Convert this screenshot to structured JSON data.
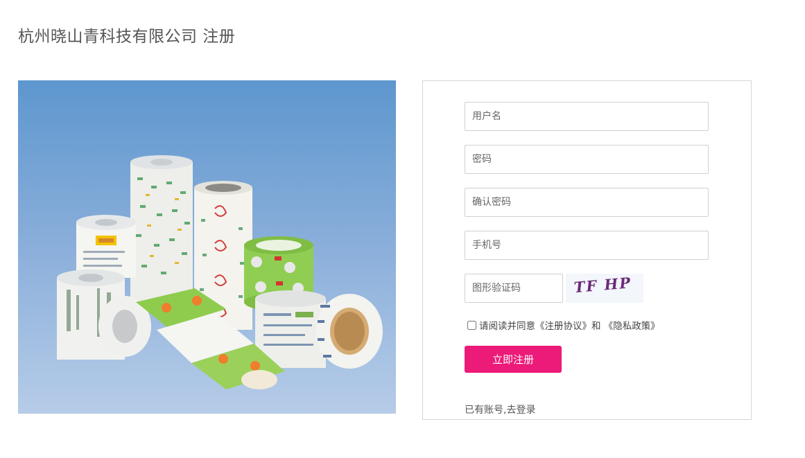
{
  "header": {
    "title": "杭州晓山青科技有限公司 注册"
  },
  "hero": {
    "image_alt": "",
    "image_icon": "packaging-rolls-photo"
  },
  "form": {
    "username_placeholder": "用户名",
    "password_placeholder": "密码",
    "confirm_password_placeholder": "确认密码",
    "phone_placeholder": "手机号",
    "captcha_placeholder": "图形验证码",
    "captcha_text": "TF HP",
    "agree_text": "请阅读并同意《注册协议》和 《隐私政策》",
    "submit_label": "立即注册",
    "login_link": "已有账号,去登录"
  },
  "colors": {
    "accent": "#ec1a78",
    "captcha_ink": "#6b2a78",
    "border": "#d0d0d0",
    "sky_top": "#5d97ce",
    "sky_bottom": "#b6cce8"
  }
}
